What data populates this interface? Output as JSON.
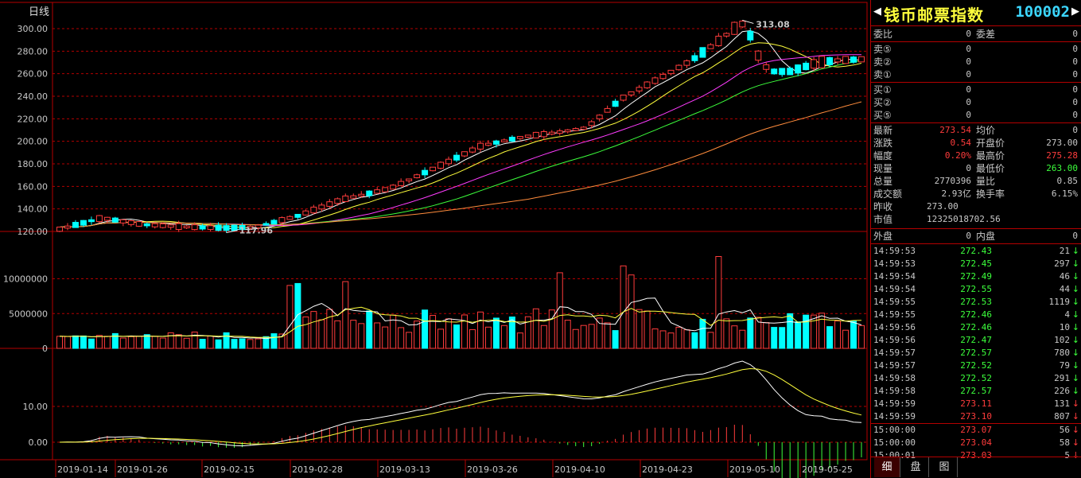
{
  "chart": {
    "period_label": "日线",
    "price_axis": [
      120,
      140,
      160,
      180,
      200,
      220,
      240,
      260,
      280,
      300
    ],
    "price_axis_labels": [
      "120.00",
      "140.00",
      "160.00",
      "180.00",
      "200.00",
      "220.00",
      "240.00",
      "260.00",
      "280.00",
      "300.00"
    ],
    "volume_axis": [
      0,
      5000000,
      10000000
    ],
    "volume_axis_labels": [
      "0",
      "5000000",
      "10000000"
    ],
    "macd_axis": [
      0,
      10
    ],
    "macd_axis_labels": [
      "0.00",
      "10.00"
    ],
    "high_label": "313.08",
    "low_label": "117.96",
    "date_labels": [
      "2019-01-14",
      "2019-01-26",
      "2019-02-15",
      "2019-02-28",
      "2019-03-13",
      "2019-03-26",
      "2019-04-10",
      "2019-04-23",
      "2019-05-10",
      "2019-05-25"
    ],
    "colors": {
      "up": "#ff3c3c",
      "down": "#00ffff",
      "ma5": "#ffffff",
      "ma10": "#ffff3c",
      "ma20": "#ff3cff",
      "ma30": "#3cff3c",
      "ma60": "#ff8c3c",
      "grid": "#b40000"
    }
  },
  "header": {
    "name": "钱币邮票指数",
    "code": "100002"
  },
  "quote": {
    "weibi": {
      "label": "委比",
      "value": "0"
    },
    "weicha": {
      "label": "委差",
      "value": "0"
    },
    "sell": [
      {
        "label": "卖⑤",
        "price": "0",
        "vol": "0"
      },
      {
        "label": "卖②",
        "price": "0",
        "vol": "0"
      },
      {
        "label": "卖①",
        "price": "0",
        "vol": "0"
      }
    ],
    "buy": [
      {
        "label": "买①",
        "price": "0",
        "vol": "0"
      },
      {
        "label": "买②",
        "price": "0",
        "vol": "0"
      },
      {
        "label": "买⑤",
        "price": "0",
        "vol": "0"
      }
    ],
    "stats": [
      {
        "l1": "最新",
        "v1": "273.54",
        "c1": "red",
        "l2": "均价",
        "v2": "0",
        "c2": ""
      },
      {
        "l1": "涨跌",
        "v1": "0.54",
        "c1": "red",
        "l2": "开盘价",
        "v2": "273.00",
        "c2": ""
      },
      {
        "l1": "幅度",
        "v1": "0.20%",
        "c1": "red",
        "l2": "最高价",
        "v2": "275.28",
        "c2": "red"
      },
      {
        "l1": "现量",
        "v1": "0",
        "c1": "",
        "l2": "最低价",
        "v2": "263.00",
        "c2": "green"
      },
      {
        "l1": "总量",
        "v1": "2770396",
        "c1": "",
        "l2": "量比",
        "v2": "0.85",
        "c2": ""
      },
      {
        "l1": "成交额",
        "v1": "2.93亿",
        "c1": "",
        "l2": "换手率",
        "v2": "6.15%",
        "c2": ""
      },
      {
        "l1": "昨收",
        "v1": "273.00",
        "c1": "",
        "l2": "",
        "v2": "",
        "c2": ""
      },
      {
        "l1": "市值",
        "v1": "12325018702.56",
        "c1": "",
        "l2": "",
        "v2": "",
        "c2": ""
      }
    ],
    "waipan": {
      "label": "外盘",
      "value": "0"
    },
    "neipan": {
      "label": "内盘",
      "value": "0"
    }
  },
  "ticks": [
    {
      "time": "14:59:53",
      "price": "272.43",
      "vol": "21",
      "dir": "↓",
      "color": "green"
    },
    {
      "time": "14:59:53",
      "price": "272.45",
      "vol": "297",
      "dir": "↓",
      "color": "green"
    },
    {
      "time": "14:59:54",
      "price": "272.49",
      "vol": "46",
      "dir": "↓",
      "color": "green"
    },
    {
      "time": "14:59:54",
      "price": "272.55",
      "vol": "44",
      "dir": "↓",
      "color": "green"
    },
    {
      "time": "14:59:55",
      "price": "272.53",
      "vol": "1119",
      "dir": "↓",
      "color": "green"
    },
    {
      "time": "14:59:55",
      "price": "272.46",
      "vol": "4",
      "dir": "↓",
      "color": "green"
    },
    {
      "time": "14:59:56",
      "price": "272.46",
      "vol": "10",
      "dir": "↓",
      "color": "green"
    },
    {
      "time": "14:59:56",
      "price": "272.47",
      "vol": "102",
      "dir": "↓",
      "color": "green"
    },
    {
      "time": "14:59:57",
      "price": "272.57",
      "vol": "780",
      "dir": "↓",
      "color": "green"
    },
    {
      "time": "14:59:57",
      "price": "272.52",
      "vol": "79",
      "dir": "↓",
      "color": "green"
    },
    {
      "time": "14:59:58",
      "price": "272.52",
      "vol": "291",
      "dir": "↓",
      "color": "green"
    },
    {
      "time": "14:59:58",
      "price": "272.57",
      "vol": "226",
      "dir": "↓",
      "color": "green"
    },
    {
      "time": "14:59:59",
      "price": "273.11",
      "vol": "131",
      "dir": "↓",
      "color": "red"
    },
    {
      "time": "14:59:59",
      "price": "273.10",
      "vol": "807",
      "dir": "↓",
      "color": "red"
    },
    {
      "time": "15:00:00",
      "price": "273.07",
      "vol": "56",
      "dir": "↓",
      "color": "red"
    },
    {
      "time": "15:00:00",
      "price": "273.04",
      "vol": "58",
      "dir": "↓",
      "color": "red"
    },
    {
      "time": "15:00:01",
      "price": "273.03",
      "vol": "5",
      "dir": "↓",
      "color": "red"
    }
  ],
  "tabs": [
    "细",
    "盘",
    "图"
  ]
}
